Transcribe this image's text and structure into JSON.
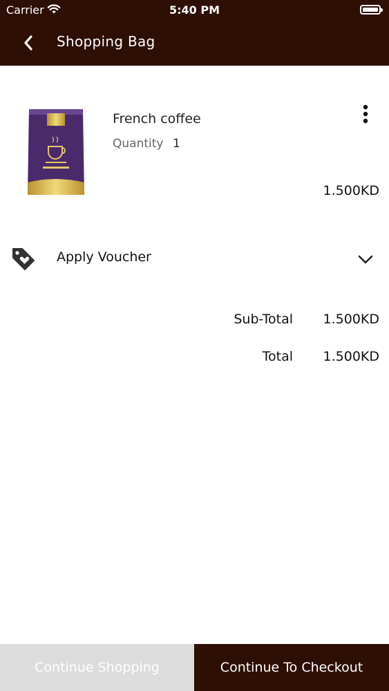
{
  "status_bar": {
    "carrier": "Carrier",
    "time": "5:40 PM"
  },
  "header": {
    "title": "Shopping Bag"
  },
  "cart": {
    "items": [
      {
        "name": "French coffee",
        "quantity_label": "Quantity",
        "quantity": "1",
        "price": "1.500KD"
      }
    ]
  },
  "voucher": {
    "label": "Apply Voucher"
  },
  "summary": {
    "subtotal_label": "Sub-Total",
    "subtotal": "1.500KD",
    "total_label": "Total",
    "total": "1.500KD"
  },
  "footer": {
    "continue_shopping": "Continue Shopping",
    "checkout": "Continue To Checkout"
  },
  "colors": {
    "brand": "#2e0f04",
    "secondary_button": "#dcdcdc"
  },
  "icons": [
    "wifi-icon",
    "battery-icon",
    "back-arrow-icon",
    "more-vertical-icon",
    "tag-heart-icon",
    "chevron-down-icon"
  ]
}
